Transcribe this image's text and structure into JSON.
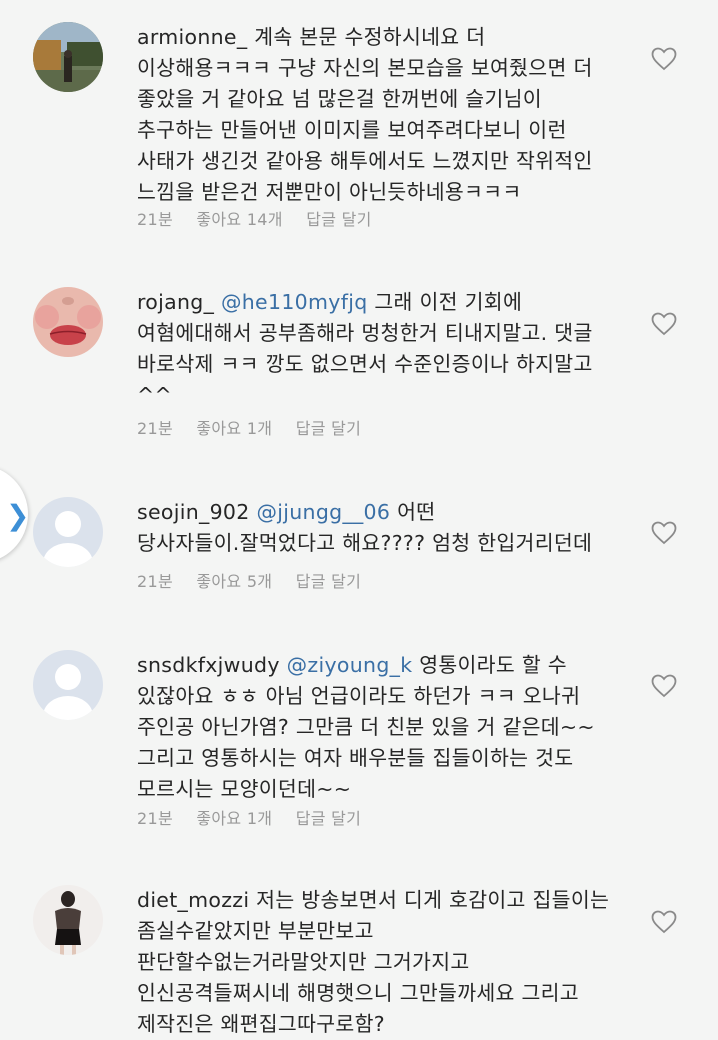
{
  "heart_icon": "heart-outline-icon",
  "side_tab_icon": "chevron-right-icon",
  "colors": {
    "mention": "#3a6fa5",
    "meta": "#999999",
    "accent": "#3d8fd6"
  },
  "comments": [
    {
      "username": "armionne_",
      "mention": "",
      "lines": [
        "계속 본문 수정하시네요 더",
        "이상해용ㅋㅋㅋ 구냥 자신의 본모습을 보여줬으면 더",
        "좋았을 거 같아요 넘 많은걸 한꺼번에 슬기님이",
        "추구하는 만들어낸 이미지를 보여주려다보니 이런",
        "사태가 생긴것 같아용 해투에서도 느꼈지만 작위적인",
        "느낌을 받은건 저뿐만이 아닌듯하네용ㅋㅋㅋ"
      ],
      "time": "21분",
      "likes": "좋아요 14개",
      "reply": "답글 달기"
    },
    {
      "username": "rojang_",
      "mention": "@he110myfjq",
      "lines": [
        "그래 이전 기회에",
        "여혐에대해서 공부좀해라 멍청한거 티내지말고. 댓글",
        "바로삭제 ㅋㅋ 깡도 없으면서 수준인증이나 하지말고",
        "^^"
      ],
      "time": "21분",
      "likes": "좋아요 1개",
      "reply": "답글 달기"
    },
    {
      "username": "seojin_902",
      "mention": "@jjungg__06",
      "lines": [
        "어떤",
        "당사자들이.잘먹었다고 해요???? 엄청 한입거리던데"
      ],
      "time": "21분",
      "likes": "좋아요 5개",
      "reply": "답글 달기"
    },
    {
      "username": "snsdkfxjwudy",
      "mention": "@ziyoung_k",
      "lines": [
        "영통이라도 할 수",
        "있잖아요 ㅎㅎ 아님 언급이라도 하던가 ㅋㅋ 오나귀",
        "주인공 아닌가염? 그만큼 더 친분 있을 거 같은데~~",
        "그리고 영통하시는 여자 배우분들 집들이하는 것도",
        "모르시는 모양이던데~~"
      ],
      "time": "21분",
      "likes": "좋아요 1개",
      "reply": "답글 달기"
    },
    {
      "username": "diet_mozzi",
      "mention": "",
      "lines": [
        "저는 방송보면서 디게 호감이고 집들이는",
        "좀실수같았지만 부분만보고",
        "판단할수없는거라말앗지만 그거가지고",
        "인신공격들쩌시네 해명햇으니 그만들까세요 그리고",
        "제작진은 왜편집그따구로함?"
      ],
      "time": "",
      "likes": "",
      "reply": ""
    }
  ]
}
